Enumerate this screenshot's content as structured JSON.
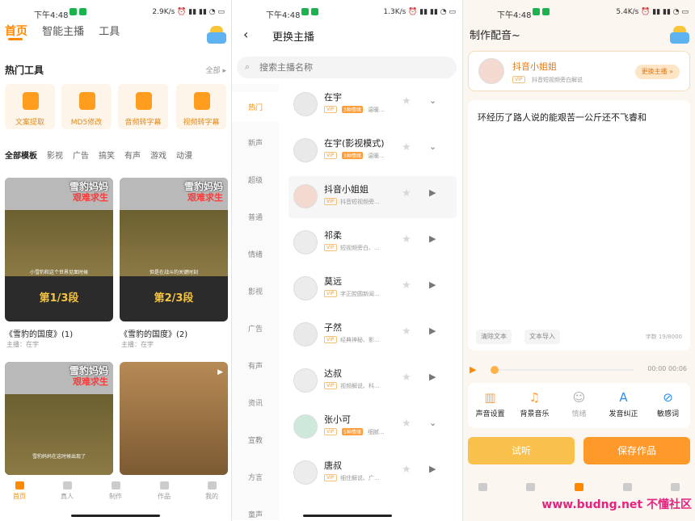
{
  "status": [
    {
      "time": "下午4:48",
      "net": "2.9K/s"
    },
    {
      "time": "下午4:48",
      "net": "1.3K/s"
    },
    {
      "time": "下午4:48",
      "net": "5.4K/s"
    }
  ],
  "home": {
    "tabs": [
      "首页",
      "智能主播",
      "工具"
    ],
    "hot_tools_title": "热门工具",
    "all_label": "全部 ▸",
    "tools": [
      "文案提取",
      "MD5修改",
      "音频转字幕",
      "视频转字幕"
    ],
    "categories": [
      "全部模板",
      "影视",
      "广告",
      "搞笑",
      "有声",
      "游戏",
      "动漫"
    ],
    "videos": [
      {
        "header": "雪豹妈妈",
        "header2": "艰难求生",
        "caption": "小雪豹和这个世界见面时候",
        "segment": "第1/3段",
        "title": "《雪豹的国度》(1)",
        "author": "主播：在宇"
      },
      {
        "header": "雪豹妈妈",
        "header2": "艰难求生",
        "caption": "但是在战斗的关键时刻",
        "segment": "第2/3段",
        "title": "《雪豹的国度》(2)",
        "author": "主播：在宇"
      },
      {
        "header": "雪豹妈妈",
        "header2": "艰难求生",
        "caption": "雪豹妈妈在这时候出现了",
        "segment": ""
      }
    ],
    "nav": [
      "首页",
      "真人",
      "制作",
      "作品",
      "我的"
    ]
  },
  "switch": {
    "title": "更换主播",
    "search_placeholder": "搜索主播名称",
    "categories": [
      "热门",
      "新声",
      "超级",
      "普通",
      "情绪",
      "影视",
      "广告",
      "有声",
      "资讯",
      "宣教",
      "方言",
      "童声"
    ],
    "anchors": [
      {
        "name": "在宇",
        "tag": "3种情绪",
        "desc": "温暖...",
        "action": "⌄"
      },
      {
        "name": "在宇(影视模式)",
        "tag": "3种情绪",
        "desc": "温暖...",
        "action": "⌄"
      },
      {
        "name": "抖音小姐姐",
        "tag": "",
        "desc": "抖音短视频旁...",
        "action": "▶"
      },
      {
        "name": "祁柔",
        "tag": "",
        "desc": "短视频旁白、...",
        "action": "▶"
      },
      {
        "name": "莫远",
        "tag": "",
        "desc": "字正腔圆新闻...",
        "action": "▶"
      },
      {
        "name": "子然",
        "tag": "",
        "desc": "经典神秘、影...",
        "action": "▶"
      },
      {
        "name": "达叔",
        "tag": "",
        "desc": "视频解说、科...",
        "action": "▶"
      },
      {
        "name": "张小可",
        "tag": "5种情绪",
        "desc": "细腻...",
        "action": "⌄"
      },
      {
        "name": "唐叔",
        "tag": "",
        "desc": "细住解说、广...",
        "action": "▶"
      }
    ]
  },
  "make": {
    "title": "制作配音~",
    "anchor_name": "抖音小姐姐",
    "anchor_desc": "抖音短视频旁白解说",
    "change_label": "更换主播 »",
    "text": "环经历了路人说的能艰苦一公斤还不飞睿和",
    "clear_label": "清除文本",
    "import_label": "文本导入",
    "count": "字数 19/8000",
    "time": "00:00  00:06",
    "tools": [
      "声音设置",
      "背景音乐",
      "情绪",
      "发音纠正",
      "敏感词"
    ],
    "preview": "试听",
    "save": "保存作品"
  },
  "vip": "VIP",
  "watermark": "www.budng.net 不懂社区"
}
